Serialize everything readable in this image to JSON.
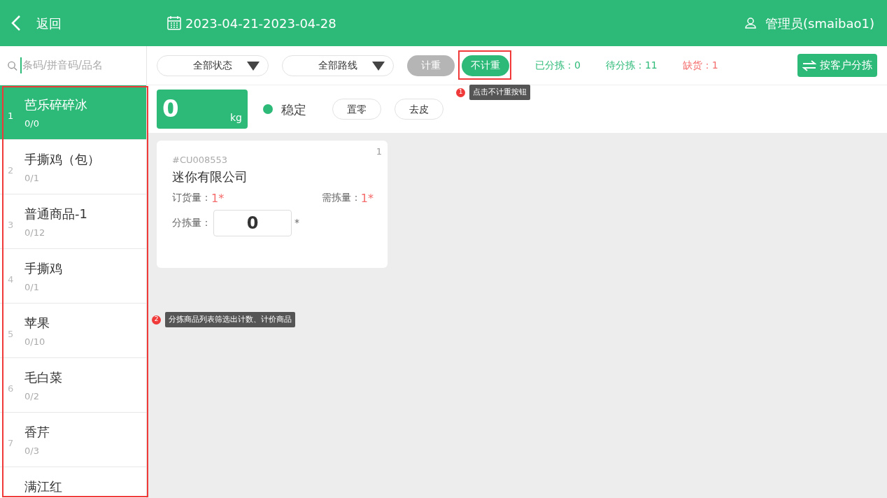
{
  "header": {
    "back_label": "返回",
    "date_range": "2023-04-21-2023-04-28",
    "user": "管理员(smaibao1)"
  },
  "search": {
    "placeholder": "条码/拼音码/品名"
  },
  "products": [
    {
      "index": "1",
      "name": "芭乐碎碎冰",
      "count": "0/0",
      "selected": true
    },
    {
      "index": "2",
      "name": "手撕鸡（包）",
      "count": "0/1",
      "selected": false
    },
    {
      "index": "3",
      "name": "普通商品-1",
      "count": "0/12",
      "selected": false
    },
    {
      "index": "4",
      "name": "手撕鸡",
      "count": "0/1",
      "selected": false
    },
    {
      "index": "5",
      "name": "苹果",
      "count": "0/10",
      "selected": false
    },
    {
      "index": "6",
      "name": "毛白菜",
      "count": "0/2",
      "selected": false
    },
    {
      "index": "7",
      "name": "香芹",
      "count": "0/3",
      "selected": false
    },
    {
      "name": "满江红",
      "selected": false
    }
  ],
  "filters": [
    "全部状态",
    "全部路线"
  ],
  "weigh_modes": [
    {
      "label": "计重",
      "selected": false
    },
    {
      "label": "不计重",
      "selected": true
    }
  ],
  "stats": [
    {
      "text": "已分拣：0",
      "kind": "ok"
    },
    {
      "text": "待分拣：11",
      "kind": "ok"
    },
    {
      "text": "缺货：1",
      "kind": "alert"
    }
  ],
  "sort_button": "按客户分拣",
  "scale": {
    "weight": "0",
    "unit": "kg",
    "stable": true,
    "status": "稳定",
    "buttons": [
      "置零",
      "去皮"
    ]
  },
  "orders": [
    {
      "number": "1",
      "code": "#CU008553",
      "customer": "迷你有限公司",
      "ordered_label": "订货量：",
      "ordered_value": "1*",
      "need_label": "需拣量：",
      "need_value": "1*",
      "picked_label": "分拣量：",
      "picked_value": "0",
      "unit": "*"
    }
  ],
  "annotations": [
    {
      "number": "1",
      "text": "点击不计重按钮"
    },
    {
      "number": "2",
      "text": "分拣商品列表筛选出计数、计价商品"
    }
  ]
}
